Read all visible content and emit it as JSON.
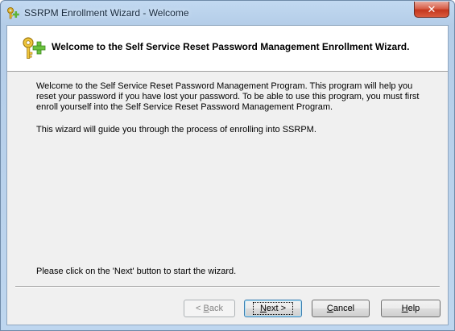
{
  "window": {
    "title": "SSRPM Enrollment Wizard - Welcome",
    "close_label": "✕"
  },
  "header": {
    "title": "Welcome to the Self Service Reset Password Management Enrollment Wizard."
  },
  "body": {
    "paragraph1": "Welcome to the Self Service Reset Password Management Program. This program will help you reset your password if you have lost your password. To be able to use this program, you must first enroll yourself into the Self Service Reset Password Management Program.",
    "paragraph2": "This wizard will guide you through the process of enrolling into SSRPM.",
    "instruction": "Please click on the 'Next' button to start the wizard."
  },
  "buttons": {
    "back": {
      "prefix": "< ",
      "mnemonic": "B",
      "rest": "ack",
      "enabled": false
    },
    "next": {
      "mnemonic": "N",
      "rest": "ext >",
      "enabled": true
    },
    "cancel": {
      "mnemonic": "C",
      "rest": "ancel",
      "enabled": true
    },
    "help": {
      "mnemonic": "H",
      "rest": "elp",
      "enabled": true
    }
  },
  "colors": {
    "titlebar": "#bed6ef",
    "client_bg": "#f0f0f0",
    "header_bg": "#ffffff",
    "close_button": "#c4371e",
    "key_icon_gold": "#e2b52a",
    "plus_icon_green": "#5fb33a"
  },
  "icons": {
    "app": "keys-plus-icon",
    "header": "keys-plus-icon"
  }
}
